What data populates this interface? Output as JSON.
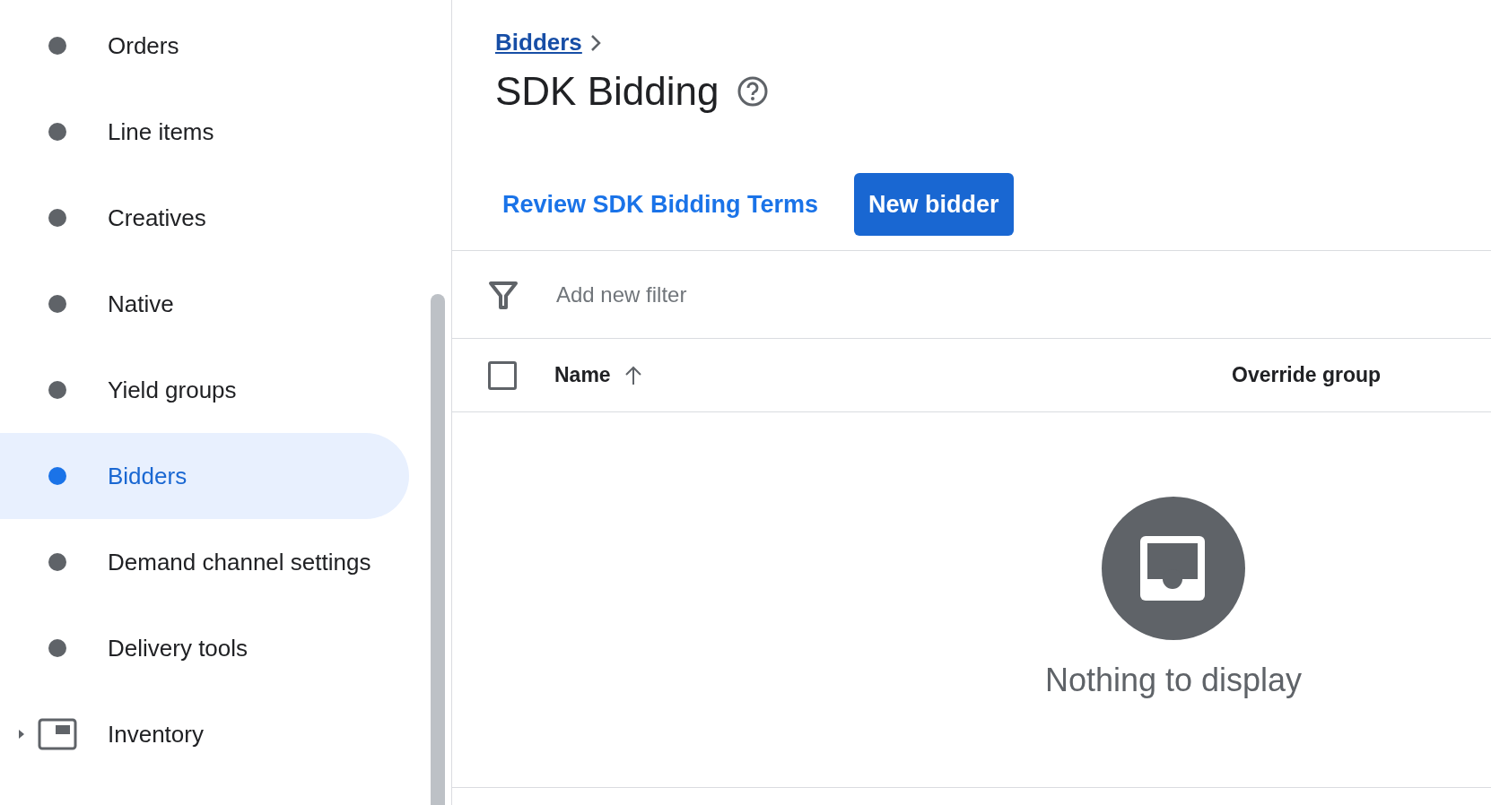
{
  "sidebar": {
    "items": [
      {
        "label": "Orders",
        "kind": "dot",
        "selected": false
      },
      {
        "label": "Line items",
        "kind": "dot",
        "selected": false
      },
      {
        "label": "Creatives",
        "kind": "dot",
        "selected": false
      },
      {
        "label": "Native",
        "kind": "dot",
        "selected": false
      },
      {
        "label": "Yield groups",
        "kind": "dot",
        "selected": false
      },
      {
        "label": "Bidders",
        "kind": "dot",
        "selected": true
      },
      {
        "label": "Demand channel settings",
        "kind": "dot",
        "selected": false
      },
      {
        "label": "Delivery tools",
        "kind": "dot",
        "selected": false
      },
      {
        "label": "Inventory",
        "kind": "section",
        "selected": false,
        "expanded": false
      }
    ]
  },
  "breadcrumb": [
    "Bidders"
  ],
  "title": "SDK Bidding",
  "actions": {
    "link": "Review SDK Bidding Terms",
    "button": "New bidder"
  },
  "filter": {
    "placeholder": "Add new filter"
  },
  "table": {
    "select_all": {
      "checked": false
    },
    "columns": [
      {
        "label": "Name",
        "sort_ascending": true
      },
      {
        "label": "Override group"
      }
    ]
  },
  "empty_state": "Nothing to display"
}
